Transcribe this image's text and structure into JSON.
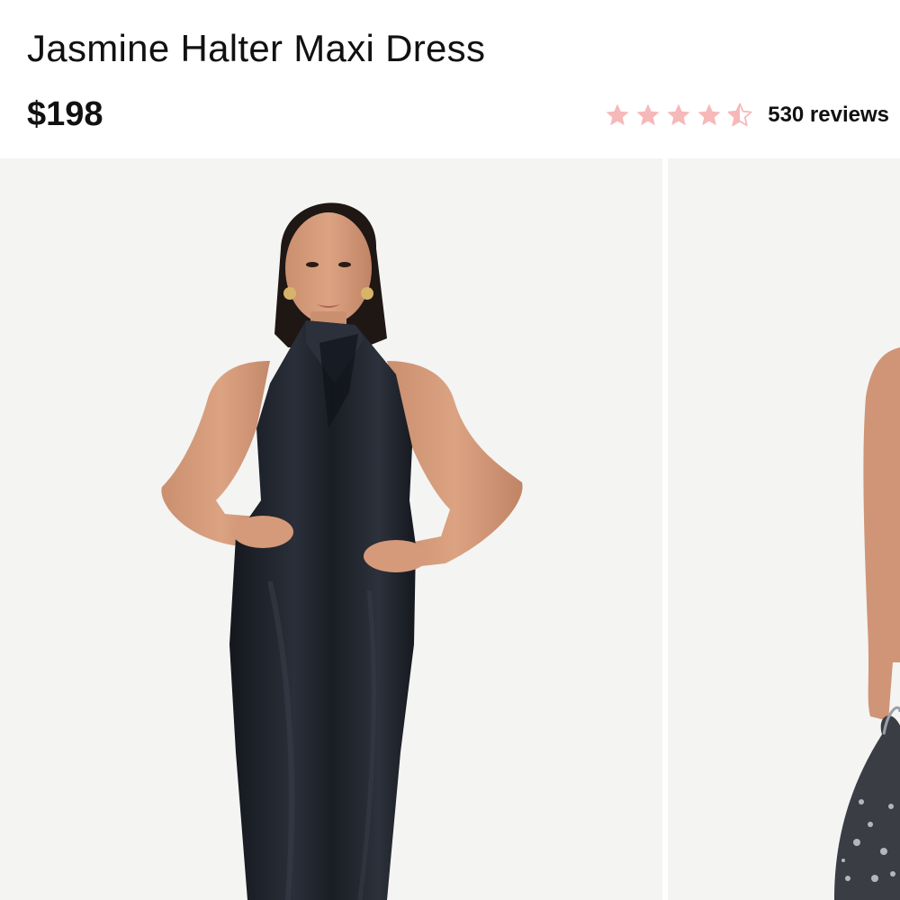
{
  "product": {
    "title": "Jasmine Halter Maxi Dress",
    "price": "$198"
  },
  "rating": {
    "value": 4.5,
    "max": 5,
    "reviews_label": "530 reviews",
    "star_color": "#f6b8b8",
    "star_empty_color": "#f6b8b8"
  },
  "gallery": {
    "images": [
      {
        "name": "model-front-photo",
        "icon": "dress-photo"
      },
      {
        "name": "model-side-photo",
        "icon": "dress-photo"
      }
    ]
  },
  "colors": {
    "background": "#ffffff",
    "photo_background": "#f4f4f3",
    "dress": "#1c1f26",
    "text": "#111111"
  }
}
